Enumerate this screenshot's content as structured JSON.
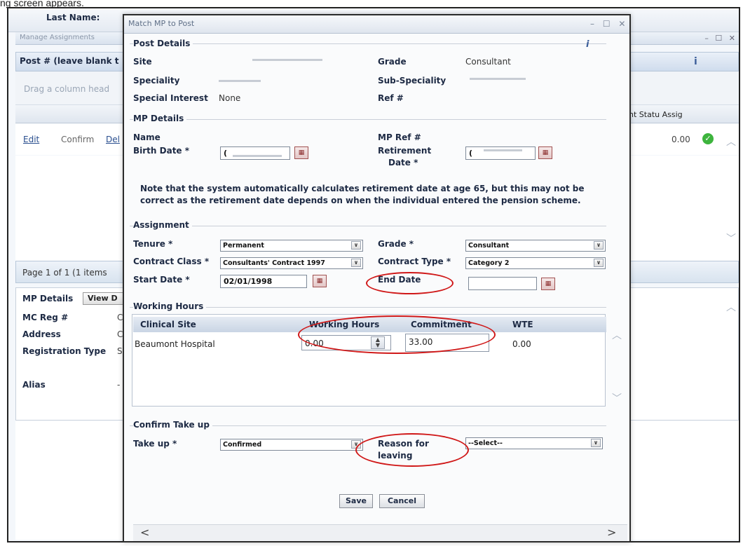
{
  "caption": "ng screen appears.",
  "background": {
    "last_name_label": "Last Name:",
    "manage_title": "Manage Assignments",
    "window_controls": "– ☐ ✕",
    "post_label": "Post # (leave blank t",
    "drag_hint": "Drag a column head",
    "column_right": "nt Statu Assig",
    "row": {
      "edit": "Edit",
      "confirm": "Confirm",
      "delete": "Del",
      "value": "0.00"
    },
    "pager": "Page 1 of 1 (1 items",
    "mp_details_tab": "MP Details",
    "view_button": "View D",
    "labels": {
      "mc_reg": "MC Reg #",
      "address": "Address",
      "registration_type": "Registration Type",
      "alias": "Alias"
    },
    "label_suffixes": {
      "mc_reg": "C",
      "address": "C",
      "registration_type": "S",
      "alias": "-"
    }
  },
  "dialog": {
    "title": "Match MP to Post",
    "window_controls": "– ☐ ✕",
    "post_details": {
      "legend": "Post Details",
      "site_label": "Site",
      "grade_label": "Grade",
      "grade_value": "Consultant",
      "speciality_label": "Speciality",
      "sub_speciality_label": "Sub-Speciality",
      "special_interest_label": "Special Interest",
      "special_interest_value": "None",
      "ref_label": "Ref #"
    },
    "mp_details": {
      "legend": "MP Details",
      "name_label": "Name",
      "mp_ref_label": "MP Ref #",
      "birth_date_label": "Birth Date *",
      "birth_date_value": "(",
      "retirement_date_label_1": "Retirement",
      "retirement_date_label_2": "Date *",
      "retirement_date_value": "(",
      "note_line_1": "Note that the system automatically calculates retirement date at age 65, but this may not be",
      "note_line_2": "correct as the retirement date depends on when the individual entered the pension scheme."
    },
    "assignment": {
      "legend": "Assignment",
      "tenure_label": "Tenure *",
      "tenure_value": "Permanent",
      "grade_label": "Grade *",
      "grade_value": "Consultant",
      "contract_class_label": "Contract Class *",
      "contract_class_value": "Consultants' Contract 1997",
      "contract_type_label": "Contract Type *",
      "contract_type_value": "Category 2",
      "start_date_label": "Start Date *",
      "start_date_value": "02/01/1998",
      "end_date_label": "End Date",
      "end_date_value": ""
    },
    "working_hours": {
      "legend": "Working Hours",
      "columns": [
        "Clinical Site",
        "Working Hours",
        "Commitment",
        "WTE"
      ],
      "rows": [
        {
          "site": "Beaumont Hospital",
          "working_hours": "0.00",
          "commitment": "33.00",
          "wte": "0.00"
        }
      ]
    },
    "confirm_take_up": {
      "legend": "Confirm Take up",
      "take_up_label": "Take up *",
      "take_up_value": "Confirmed",
      "reason_label_1": "Reason for",
      "reason_label_2": "leaving",
      "reason_value": "--Select--"
    },
    "buttons": {
      "save": "Save",
      "cancel": "Cancel"
    },
    "scroll": {
      "left": "<",
      "right": ">"
    }
  }
}
